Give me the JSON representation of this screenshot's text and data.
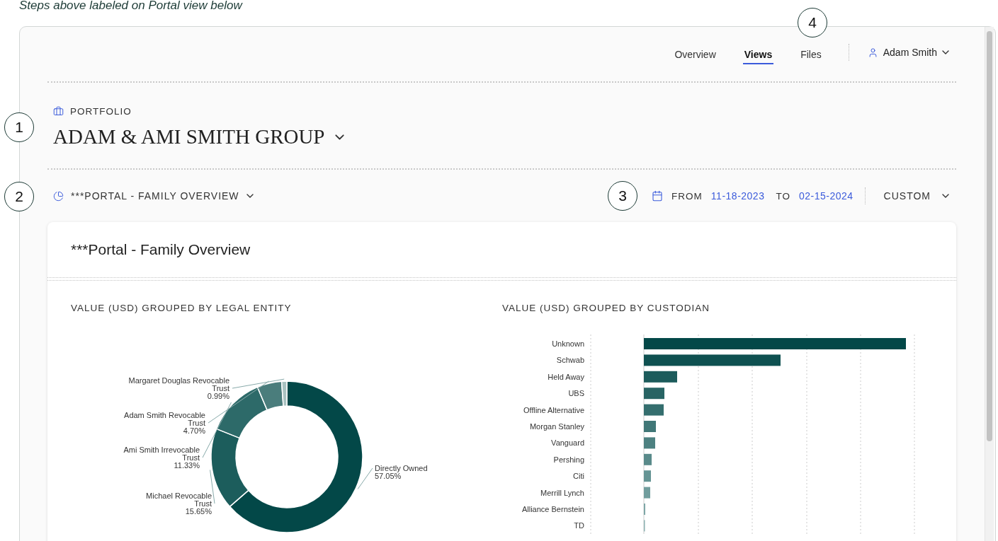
{
  "caption": "Steps above labeled on Portal view below",
  "step_markers": [
    "1",
    "2",
    "3",
    "4"
  ],
  "nav": {
    "tabs": [
      {
        "label": "Overview",
        "selected": false
      },
      {
        "label": "Views",
        "selected": true
      },
      {
        "label": "Files",
        "selected": false
      }
    ],
    "user": "Adam Smith"
  },
  "portfolio": {
    "label": "PORTFOLIO",
    "name": "ADAM & AMI SMITH GROUP"
  },
  "view_selector": {
    "label": "***PORTAL - FAMILY OVERVIEW"
  },
  "date_range": {
    "from_label": "FROM",
    "from": "11-18-2023",
    "to_label": "TO",
    "to": "02-15-2024",
    "preset": "CUSTOM"
  },
  "card": {
    "title": "***Portal - Family Overview",
    "legal_entity_chart": {
      "chart_data": {
        "type": "donut",
        "title": "VALUE (USD) GROUPED BY LEGAL ENTITY",
        "categories": [
          "Directly Owned",
          "Michael Revocable Trust",
          "Ami Smith Irrevocable Trust",
          "Adam Smith Revocable Trust",
          "Margaret Douglas Revocable Trust"
        ],
        "values": [
          57.05,
          15.65,
          11.33,
          4.7,
          0.99
        ],
        "value_labels": [
          "57.05%",
          "15.65%",
          "11.33%",
          "4.70%",
          "0.99%"
        ]
      }
    },
    "custodian_chart": {
      "title": "VALUE (USD) GROUPED BY CUSTODIAN",
      "categories": [
        "Unknown",
        "Schwab",
        "Held Away",
        "UBS",
        "Offline Alternative",
        "Morgan Stanley",
        "Vanguard",
        "Pershing",
        "Citi",
        "Merrill Lynch",
        "Alliance Bernstein",
        "TD"
      ]
    }
  }
}
